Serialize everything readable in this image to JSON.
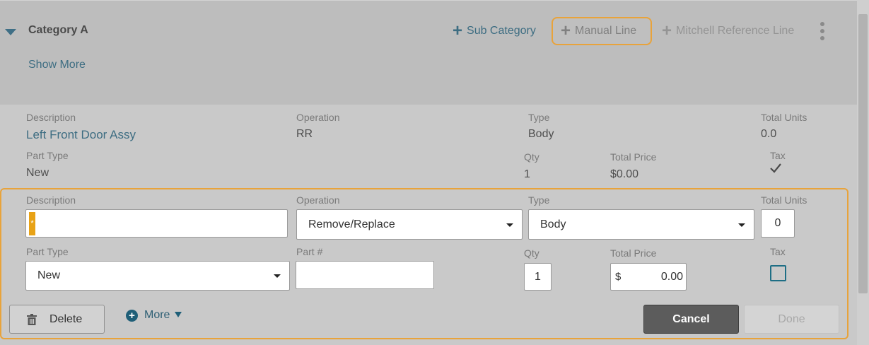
{
  "category": {
    "title": "Category A",
    "show_more": "Show More",
    "toolbar": {
      "sub_category": "Sub Category",
      "manual_line": "Manual Line",
      "mitchell_reference_line": "Mitchell Reference Line"
    }
  },
  "existing_line": {
    "labels": {
      "description": "Description",
      "operation": "Operation",
      "type": "Type",
      "total_units": "Total Units",
      "part_type": "Part Type",
      "qty": "Qty",
      "total_price": "Total Price",
      "tax": "Tax"
    },
    "values": {
      "description": "Left Front Door Assy",
      "operation": "RR",
      "type": "Body",
      "total_units": "0.0",
      "part_type": "New",
      "qty": "1",
      "total_price": "$0.00",
      "tax_checked": true
    }
  },
  "edit_form": {
    "labels": {
      "description": "Description",
      "operation": "Operation",
      "type": "Type",
      "total_units": "Total Units",
      "part_type": "Part Type",
      "part_number": "Part #",
      "qty": "Qty",
      "total_price": "Total Price",
      "tax": "Tax"
    },
    "values": {
      "description": "",
      "required_marker": "*",
      "operation": "Remove/Replace",
      "type": "Body",
      "total_units": "0",
      "part_type": "New",
      "part_number": "",
      "qty": "1",
      "currency_symbol": "$",
      "total_price": "0.00",
      "tax_checked": false
    },
    "buttons": {
      "delete": "Delete",
      "more": "More",
      "cancel": "Cancel",
      "done": "Done"
    }
  },
  "colors": {
    "accent_orange": "#e8a33b",
    "link_teal": "#3d6d82",
    "cancel_dark": "#5c5c5c"
  }
}
